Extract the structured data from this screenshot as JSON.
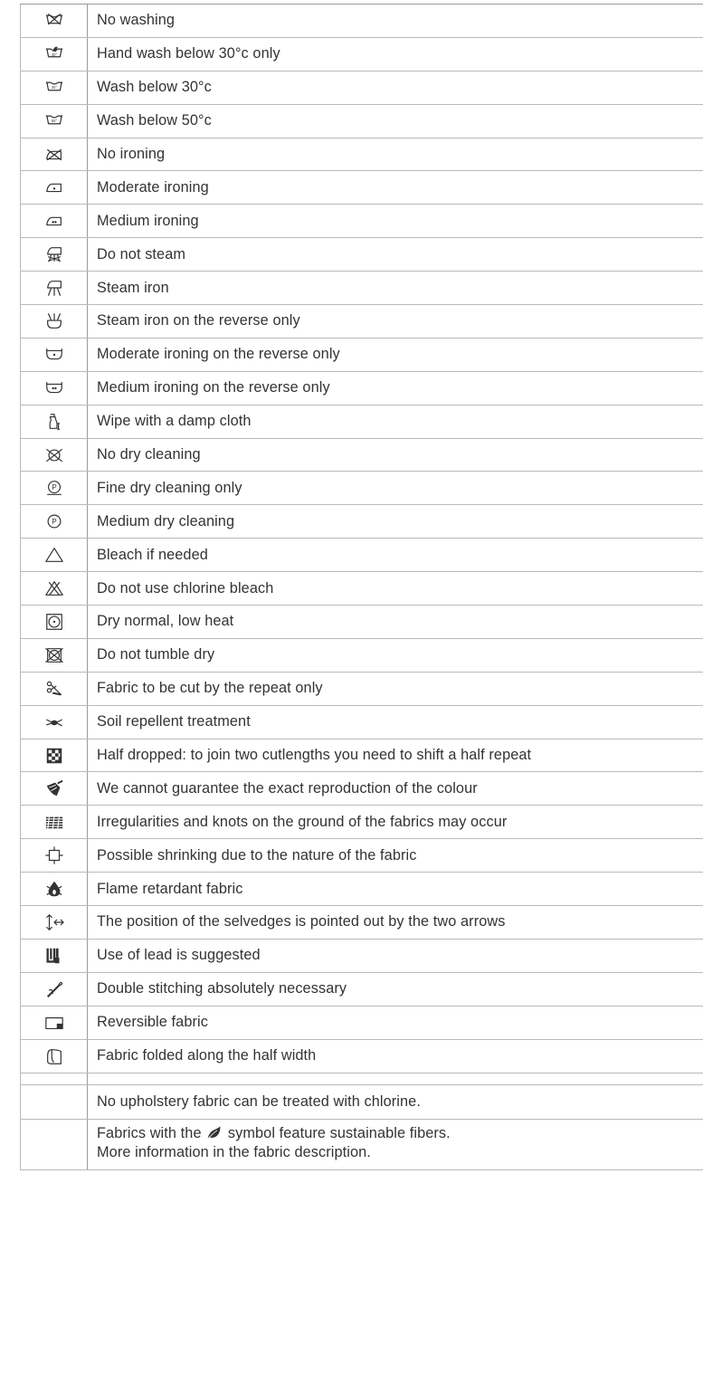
{
  "legend": {
    "rows": [
      {
        "icon": "no-washing-icon",
        "label": "No washing"
      },
      {
        "icon": "hand-wash-30-icon",
        "label": "Hand wash below 30°c only"
      },
      {
        "icon": "wash-30-icon",
        "label": "Wash below 30°c"
      },
      {
        "icon": "wash-50-icon",
        "label": "Wash below 50°c"
      },
      {
        "icon": "no-ironing-icon",
        "label": "No ironing"
      },
      {
        "icon": "iron-one-dot-icon",
        "label": "Moderate ironing"
      },
      {
        "icon": "iron-two-dots-icon",
        "label": "Medium ironing"
      },
      {
        "icon": "no-steam-icon",
        "label": "Do not steam"
      },
      {
        "icon": "steam-iron-icon",
        "label": "Steam iron"
      },
      {
        "icon": "steam-iron-reverse-icon",
        "label": "Steam iron on the reverse only"
      },
      {
        "icon": "iron-reverse-one-dot-icon",
        "label": "Moderate ironing on the reverse only"
      },
      {
        "icon": "iron-reverse-two-dots-icon",
        "label": "Medium ironing on the reverse only"
      },
      {
        "icon": "spray-bottle-icon",
        "label": "Wipe with a damp cloth"
      },
      {
        "icon": "no-dry-clean-icon",
        "label": "No dry cleaning"
      },
      {
        "icon": "dry-clean-p-fine-icon",
        "label": "Fine dry cleaning only"
      },
      {
        "icon": "dry-clean-p-icon",
        "label": "Medium dry cleaning"
      },
      {
        "icon": "bleach-triangle-icon",
        "label": "Bleach if needed"
      },
      {
        "icon": "no-bleach-icon",
        "label": "Do not use chlorine bleach"
      },
      {
        "icon": "tumble-dry-low-icon",
        "label": "Dry normal, low heat"
      },
      {
        "icon": "no-tumble-dry-icon",
        "label": "Do not tumble dry"
      },
      {
        "icon": "scissors-icon",
        "label": "Fabric to be cut by the repeat only"
      },
      {
        "icon": "soil-repellent-icon",
        "label": "Soil repellent treatment"
      },
      {
        "icon": "half-drop-icon",
        "label": "Half dropped: to join two cutlengths you need to shift a half repeat"
      },
      {
        "icon": "paint-brush-icon",
        "label": "We cannot guarantee the exact reproduction of the colour"
      },
      {
        "icon": "fabric-texture-icon",
        "label": "Irregularities and knots on the ground of the fabrics may occur"
      },
      {
        "icon": "shrink-icon",
        "label": "Possible shrinking due to the nature of the fabric"
      },
      {
        "icon": "flame-icon",
        "label": "Flame retardant fabric"
      },
      {
        "icon": "selvedge-arrows-icon",
        "label": "The position of the selvedges is pointed out by the two arrows"
      },
      {
        "icon": "lead-weight-icon",
        "label": "Use of lead is suggested"
      },
      {
        "icon": "needle-icon",
        "label": "Double stitching absolutely necessary"
      },
      {
        "icon": "reversible-icon",
        "label": "Reversible fabric"
      },
      {
        "icon": "folded-fabric-icon",
        "label": "Fabric folded along the half width"
      }
    ],
    "note_chlorine": "No upholstery fabric can be treated with chlorine.",
    "note_sustainable_before": "Fabrics with the",
    "note_sustainable_after": "symbol feature sustainable fibers.",
    "note_sustainable_line2": "More information in the fabric description.",
    "leaf_icon": "leaf-icon"
  }
}
